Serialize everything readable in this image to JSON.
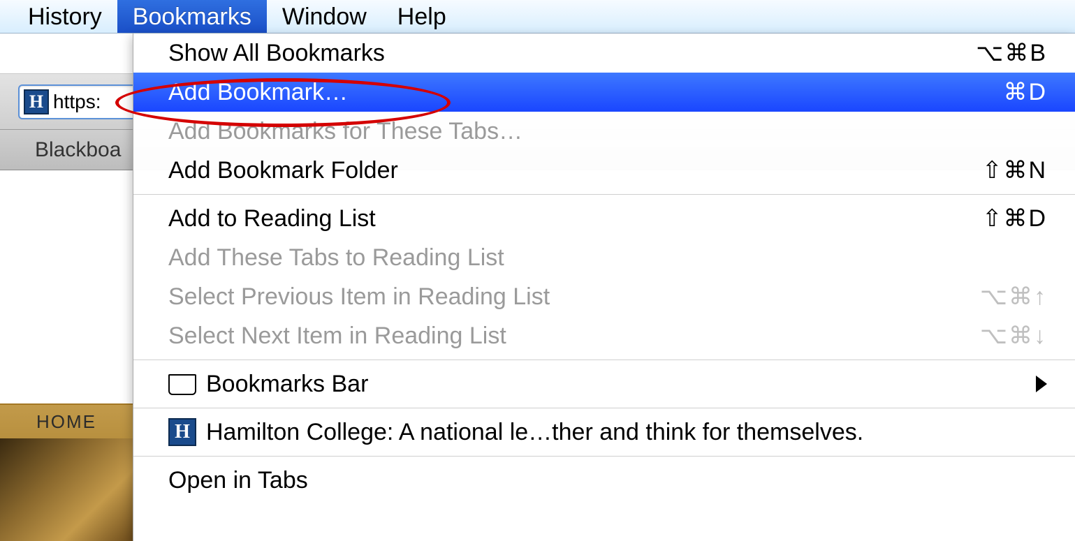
{
  "menubar": {
    "items": [
      {
        "label": "History"
      },
      {
        "label": "Bookmarks"
      },
      {
        "label": "Window"
      },
      {
        "label": "Help"
      }
    ],
    "active_index": 1
  },
  "toolbar": {
    "url_text": "https:",
    "favicon_letter": "H",
    "bookmark_bar_item": "Blackboa"
  },
  "page": {
    "nav_item": "HOME"
  },
  "menu": {
    "items": [
      {
        "label": "Show All Bookmarks",
        "shortcut": "⌥⌘B",
        "disabled": false
      },
      {
        "label": "Add Bookmark…",
        "shortcut": "⌘D",
        "disabled": false,
        "highlight": true
      },
      {
        "label": "Add Bookmarks for These Tabs…",
        "shortcut": "",
        "disabled": true
      },
      {
        "label": "Add Bookmark Folder",
        "shortcut": "⇧⌘N",
        "disabled": false
      },
      {
        "sep": true
      },
      {
        "label": "Add to Reading List",
        "shortcut": "⇧⌘D",
        "disabled": false
      },
      {
        "label": "Add These Tabs to Reading List",
        "shortcut": "",
        "disabled": true
      },
      {
        "label": "Select Previous Item in Reading List",
        "shortcut": "⌥⌘↑",
        "disabled": true
      },
      {
        "label": "Select Next Item in Reading List",
        "shortcut": "⌥⌘↓",
        "disabled": true
      },
      {
        "sep": true
      },
      {
        "label": "Bookmarks Bar",
        "shortcut": "",
        "disabled": false,
        "icon": "book",
        "submenu": true
      },
      {
        "sep": true
      },
      {
        "label": "Hamilton College: A national le…ther and think for themselves.",
        "shortcut": "",
        "disabled": false,
        "icon": "hfav"
      },
      {
        "sep": true
      },
      {
        "label": "Open in Tabs",
        "shortcut": "",
        "disabled": false
      }
    ]
  }
}
